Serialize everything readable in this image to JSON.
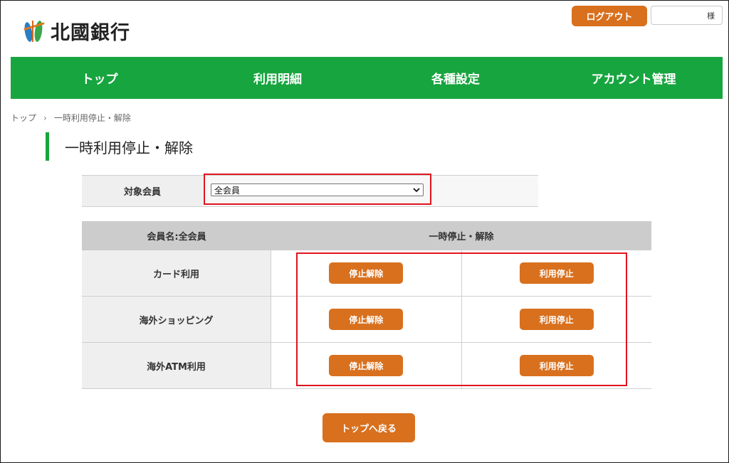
{
  "header": {
    "bank_name": "北國銀行",
    "logout_label": "ログアウト",
    "user_suffix": "様"
  },
  "nav": {
    "items": [
      {
        "label": "トップ"
      },
      {
        "label": "利用明細"
      },
      {
        "label": "各種設定"
      },
      {
        "label": "アカウント管理"
      }
    ]
  },
  "breadcrumb": {
    "home": "トップ",
    "separator": "›",
    "current": "一時利用停止・解除"
  },
  "page": {
    "title": "一時利用停止・解除"
  },
  "member_select": {
    "label": "対象会員",
    "selected": "全会員"
  },
  "table": {
    "header_member": "会員名:全会員",
    "header_action": "一時停止・解除",
    "rows": [
      {
        "label": "カード利用",
        "release_label": "停止解除",
        "suspend_label": "利用停止"
      },
      {
        "label": "海外ショッピング",
        "release_label": "停止解除",
        "suspend_label": "利用停止"
      },
      {
        "label": "海外ATM利用",
        "release_label": "停止解除",
        "suspend_label": "利用停止"
      }
    ]
  },
  "footer": {
    "back_label": "トップへ戻る"
  },
  "colors": {
    "brand_green": "#17a53f",
    "button_orange": "#d8701e",
    "highlight_red": "#e0141e"
  }
}
